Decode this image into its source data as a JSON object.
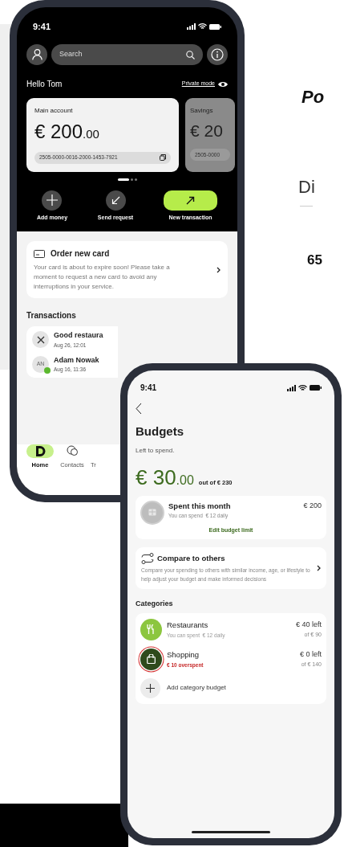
{
  "side_text": [
    {
      "text": "Po",
      "kind": "heading"
    },
    {
      "text": "Di",
      "kind": "body"
    },
    {
      "text": "65",
      "kind": "number"
    }
  ],
  "home_phone": {
    "time": "9:41",
    "search": {
      "placeholder": "Search"
    },
    "greeting": "Hello Tom",
    "private_mode": "Private mode",
    "accounts": [
      {
        "name": "Main account",
        "amount": "€ 200",
        "cents": ".00",
        "number": "2505-0000-0016-2000-1453-7921",
        "selected": true
      },
      {
        "name": "Savings",
        "amount": "€ 20",
        "number": "2505-0000",
        "selected": false
      }
    ],
    "pager": [
      {
        "selected": true
      },
      {
        "selected": false
      },
      {
        "selected": false
      }
    ],
    "actions": [
      {
        "label": "Add money",
        "kind": "add",
        "highlighted": false
      },
      {
        "label": "Send request",
        "kind": "request",
        "highlighted": false
      },
      {
        "label": "New transaction",
        "kind": "send",
        "highlighted": true
      }
    ],
    "order_card": {
      "title": "Order new card",
      "text": "Your card is about to expire soon! Please take a moment to request a new card to avoid any interruptions in your service."
    },
    "transactions_title": "Transactions",
    "transactions": [
      {
        "name": "Good restaura",
        "time": "Aug 26, 12:01",
        "kind": "restaurant"
      },
      {
        "name": "Adam Nowak",
        "time": "Aug 16, 11:36",
        "kind": "person",
        "initials": "AN"
      }
    ],
    "nav": [
      {
        "label": "Home",
        "kind": "home",
        "selected": true
      },
      {
        "label": "Contacts",
        "kind": "contacts",
        "selected": false
      },
      {
        "label": "Tr",
        "kind": "other",
        "selected": false
      }
    ]
  },
  "budgets_phone": {
    "time": "9:41",
    "title": "Budgets",
    "subtitle": "Left to spend.",
    "amount": "€ 30",
    "cents": ".00",
    "out_of": "out of € 230",
    "spent": {
      "title": "Spent this month",
      "note": "You can spend  € 12 daily",
      "amount": "€ 200",
      "link": "Edit budget limit"
    },
    "compare": {
      "title": "Compare to others",
      "text": "Compare your spending to others with similar income, age, or lifestyle to help adjust your budget and make informed decisions"
    },
    "categories_title": "Categories",
    "categories": [
      {
        "name": "Restaurants",
        "note": "You can spent  € 12 daily",
        "left": "€ 40 left",
        "of": "of € 90",
        "kind": "restaurant",
        "overspent": false,
        "color": "#8cc63f"
      },
      {
        "name": "Shopping",
        "note": "€ 10 overspent",
        "left": "€ 0 left",
        "of": "of € 140",
        "kind": "shopping",
        "overspent": true,
        "color": "#2f4a1c"
      }
    ],
    "add_label": "Add category budget"
  }
}
